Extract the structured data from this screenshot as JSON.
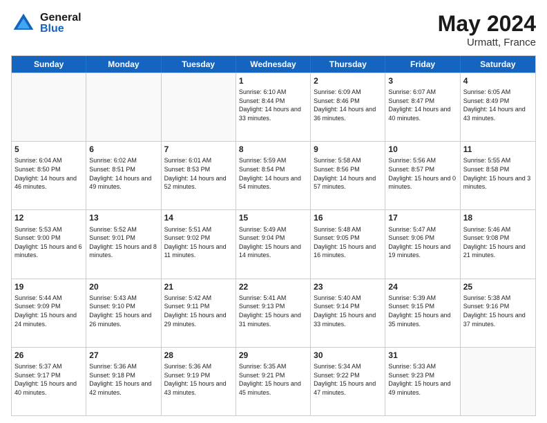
{
  "header": {
    "logo_general": "General",
    "logo_blue": "Blue",
    "month_year": "May 2024",
    "location": "Urmatt, France"
  },
  "days_of_week": [
    "Sunday",
    "Monday",
    "Tuesday",
    "Wednesday",
    "Thursday",
    "Friday",
    "Saturday"
  ],
  "weeks": [
    [
      {
        "day": "",
        "empty": true
      },
      {
        "day": "",
        "empty": true
      },
      {
        "day": "",
        "empty": true
      },
      {
        "day": "1",
        "sunrise": "Sunrise: 6:10 AM",
        "sunset": "Sunset: 8:44 PM",
        "daylight": "Daylight: 14 hours and 33 minutes."
      },
      {
        "day": "2",
        "sunrise": "Sunrise: 6:09 AM",
        "sunset": "Sunset: 8:46 PM",
        "daylight": "Daylight: 14 hours and 36 minutes."
      },
      {
        "day": "3",
        "sunrise": "Sunrise: 6:07 AM",
        "sunset": "Sunset: 8:47 PM",
        "daylight": "Daylight: 14 hours and 40 minutes."
      },
      {
        "day": "4",
        "sunrise": "Sunrise: 6:05 AM",
        "sunset": "Sunset: 8:49 PM",
        "daylight": "Daylight: 14 hours and 43 minutes."
      }
    ],
    [
      {
        "day": "5",
        "sunrise": "Sunrise: 6:04 AM",
        "sunset": "Sunset: 8:50 PM",
        "daylight": "Daylight: 14 hours and 46 minutes."
      },
      {
        "day": "6",
        "sunrise": "Sunrise: 6:02 AM",
        "sunset": "Sunset: 8:51 PM",
        "daylight": "Daylight: 14 hours and 49 minutes."
      },
      {
        "day": "7",
        "sunrise": "Sunrise: 6:01 AM",
        "sunset": "Sunset: 8:53 PM",
        "daylight": "Daylight: 14 hours and 52 minutes."
      },
      {
        "day": "8",
        "sunrise": "Sunrise: 5:59 AM",
        "sunset": "Sunset: 8:54 PM",
        "daylight": "Daylight: 14 hours and 54 minutes."
      },
      {
        "day": "9",
        "sunrise": "Sunrise: 5:58 AM",
        "sunset": "Sunset: 8:56 PM",
        "daylight": "Daylight: 14 hours and 57 minutes."
      },
      {
        "day": "10",
        "sunrise": "Sunrise: 5:56 AM",
        "sunset": "Sunset: 8:57 PM",
        "daylight": "Daylight: 15 hours and 0 minutes."
      },
      {
        "day": "11",
        "sunrise": "Sunrise: 5:55 AM",
        "sunset": "Sunset: 8:58 PM",
        "daylight": "Daylight: 15 hours and 3 minutes."
      }
    ],
    [
      {
        "day": "12",
        "sunrise": "Sunrise: 5:53 AM",
        "sunset": "Sunset: 9:00 PM",
        "daylight": "Daylight: 15 hours and 6 minutes."
      },
      {
        "day": "13",
        "sunrise": "Sunrise: 5:52 AM",
        "sunset": "Sunset: 9:01 PM",
        "daylight": "Daylight: 15 hours and 8 minutes."
      },
      {
        "day": "14",
        "sunrise": "Sunrise: 5:51 AM",
        "sunset": "Sunset: 9:02 PM",
        "daylight": "Daylight: 15 hours and 11 minutes."
      },
      {
        "day": "15",
        "sunrise": "Sunrise: 5:49 AM",
        "sunset": "Sunset: 9:04 PM",
        "daylight": "Daylight: 15 hours and 14 minutes."
      },
      {
        "day": "16",
        "sunrise": "Sunrise: 5:48 AM",
        "sunset": "Sunset: 9:05 PM",
        "daylight": "Daylight: 15 hours and 16 minutes."
      },
      {
        "day": "17",
        "sunrise": "Sunrise: 5:47 AM",
        "sunset": "Sunset: 9:06 PM",
        "daylight": "Daylight: 15 hours and 19 minutes."
      },
      {
        "day": "18",
        "sunrise": "Sunrise: 5:46 AM",
        "sunset": "Sunset: 9:08 PM",
        "daylight": "Daylight: 15 hours and 21 minutes."
      }
    ],
    [
      {
        "day": "19",
        "sunrise": "Sunrise: 5:44 AM",
        "sunset": "Sunset: 9:09 PM",
        "daylight": "Daylight: 15 hours and 24 minutes."
      },
      {
        "day": "20",
        "sunrise": "Sunrise: 5:43 AM",
        "sunset": "Sunset: 9:10 PM",
        "daylight": "Daylight: 15 hours and 26 minutes."
      },
      {
        "day": "21",
        "sunrise": "Sunrise: 5:42 AM",
        "sunset": "Sunset: 9:11 PM",
        "daylight": "Daylight: 15 hours and 29 minutes."
      },
      {
        "day": "22",
        "sunrise": "Sunrise: 5:41 AM",
        "sunset": "Sunset: 9:13 PM",
        "daylight": "Daylight: 15 hours and 31 minutes."
      },
      {
        "day": "23",
        "sunrise": "Sunrise: 5:40 AM",
        "sunset": "Sunset: 9:14 PM",
        "daylight": "Daylight: 15 hours and 33 minutes."
      },
      {
        "day": "24",
        "sunrise": "Sunrise: 5:39 AM",
        "sunset": "Sunset: 9:15 PM",
        "daylight": "Daylight: 15 hours and 35 minutes."
      },
      {
        "day": "25",
        "sunrise": "Sunrise: 5:38 AM",
        "sunset": "Sunset: 9:16 PM",
        "daylight": "Daylight: 15 hours and 37 minutes."
      }
    ],
    [
      {
        "day": "26",
        "sunrise": "Sunrise: 5:37 AM",
        "sunset": "Sunset: 9:17 PM",
        "daylight": "Daylight: 15 hours and 40 minutes."
      },
      {
        "day": "27",
        "sunrise": "Sunrise: 5:36 AM",
        "sunset": "Sunset: 9:18 PM",
        "daylight": "Daylight: 15 hours and 42 minutes."
      },
      {
        "day": "28",
        "sunrise": "Sunrise: 5:36 AM",
        "sunset": "Sunset: 9:19 PM",
        "daylight": "Daylight: 15 hours and 43 minutes."
      },
      {
        "day": "29",
        "sunrise": "Sunrise: 5:35 AM",
        "sunset": "Sunset: 9:21 PM",
        "daylight": "Daylight: 15 hours and 45 minutes."
      },
      {
        "day": "30",
        "sunrise": "Sunrise: 5:34 AM",
        "sunset": "Sunset: 9:22 PM",
        "daylight": "Daylight: 15 hours and 47 minutes."
      },
      {
        "day": "31",
        "sunrise": "Sunrise: 5:33 AM",
        "sunset": "Sunset: 9:23 PM",
        "daylight": "Daylight: 15 hours and 49 minutes."
      },
      {
        "day": "",
        "empty": true
      }
    ]
  ]
}
